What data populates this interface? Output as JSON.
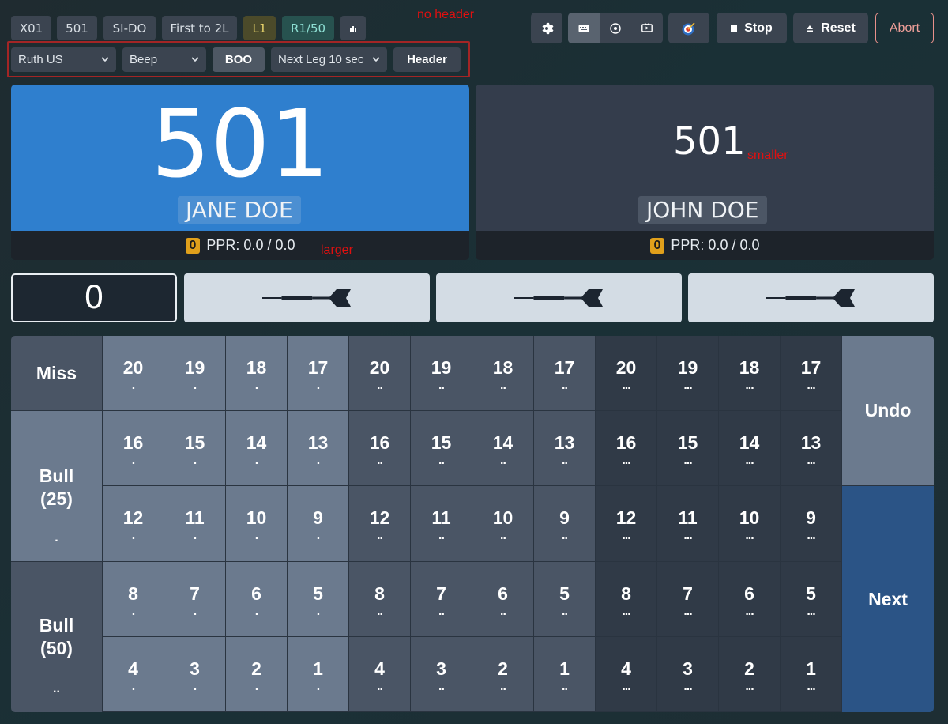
{
  "header": {
    "chips": [
      "X01",
      "501",
      "SI-DO",
      "First to 2L",
      "L1",
      "R1/50"
    ],
    "stats_icon": "bar-chart-icon",
    "settings_icon": "gear-icon",
    "view_icons": [
      "keyboard-icon",
      "target-circle-icon",
      "monitor-icon"
    ],
    "dartboard_icon": "dartboard-icon",
    "stop_label": "Stop",
    "reset_label": "Reset",
    "abort_label": "Abort"
  },
  "options": {
    "voice_select": "Ruth US",
    "sound_select": "Beep",
    "boo_label": "BOO",
    "next_leg_select": "Next Leg 10 sec",
    "header_label": "Header"
  },
  "annotations": {
    "no_header": "no header",
    "smaller": "smaller",
    "larger": "larger"
  },
  "players": [
    {
      "score": "501",
      "name": "JANE DOE",
      "badge": "0",
      "ppr": "PPR: 0.0 / 0.0"
    },
    {
      "score": "501",
      "name": "JOHN DOE",
      "badge": "0",
      "ppr": "PPR: 0.0 / 0.0"
    }
  ],
  "input": {
    "value": "0"
  },
  "keypad": {
    "miss": "Miss",
    "bull25": [
      "Bull",
      "(25)"
    ],
    "bull50": [
      "Bull",
      "(50)"
    ],
    "undo": "Undo",
    "next": "Next",
    "rows": [
      [
        "20",
        "19",
        "18",
        "17"
      ],
      [
        "16",
        "15",
        "14",
        "13"
      ],
      [
        "12",
        "11",
        "10",
        "9"
      ],
      [
        "8",
        "7",
        "6",
        "5"
      ],
      [
        "4",
        "3",
        "2",
        "1"
      ]
    ],
    "multiplier_dots": [
      ".",
      "..",
      "..."
    ]
  },
  "colors": {
    "accent_blue": "#2f7fce",
    "single": "#6b7a8e",
    "double": "#4a5565",
    "triple": "#303a47",
    "next": "#2b5486",
    "undo": "#6b7a8e"
  }
}
